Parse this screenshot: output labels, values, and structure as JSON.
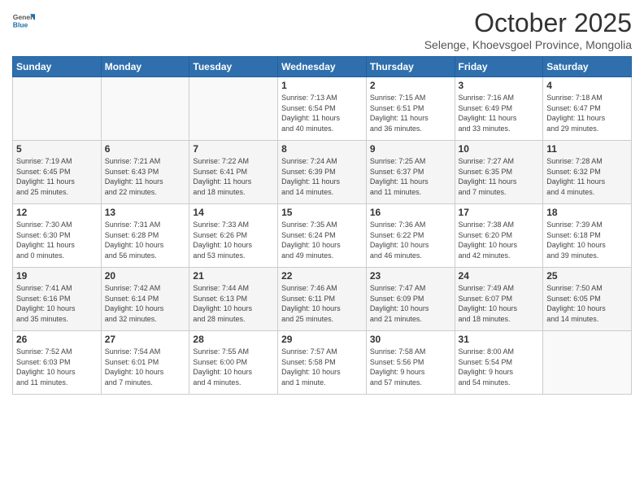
{
  "header": {
    "logo_general": "General",
    "logo_blue": "Blue",
    "title": "October 2025",
    "subtitle": "Selenge, Khoevsgoel Province, Mongolia"
  },
  "weekdays": [
    "Sunday",
    "Monday",
    "Tuesday",
    "Wednesday",
    "Thursday",
    "Friday",
    "Saturday"
  ],
  "weeks": [
    [
      {
        "day": "",
        "info": ""
      },
      {
        "day": "",
        "info": ""
      },
      {
        "day": "",
        "info": ""
      },
      {
        "day": "1",
        "info": "Sunrise: 7:13 AM\nSunset: 6:54 PM\nDaylight: 11 hours\nand 40 minutes."
      },
      {
        "day": "2",
        "info": "Sunrise: 7:15 AM\nSunset: 6:51 PM\nDaylight: 11 hours\nand 36 minutes."
      },
      {
        "day": "3",
        "info": "Sunrise: 7:16 AM\nSunset: 6:49 PM\nDaylight: 11 hours\nand 33 minutes."
      },
      {
        "day": "4",
        "info": "Sunrise: 7:18 AM\nSunset: 6:47 PM\nDaylight: 11 hours\nand 29 minutes."
      }
    ],
    [
      {
        "day": "5",
        "info": "Sunrise: 7:19 AM\nSunset: 6:45 PM\nDaylight: 11 hours\nand 25 minutes."
      },
      {
        "day": "6",
        "info": "Sunrise: 7:21 AM\nSunset: 6:43 PM\nDaylight: 11 hours\nand 22 minutes."
      },
      {
        "day": "7",
        "info": "Sunrise: 7:22 AM\nSunset: 6:41 PM\nDaylight: 11 hours\nand 18 minutes."
      },
      {
        "day": "8",
        "info": "Sunrise: 7:24 AM\nSunset: 6:39 PM\nDaylight: 11 hours\nand 14 minutes."
      },
      {
        "day": "9",
        "info": "Sunrise: 7:25 AM\nSunset: 6:37 PM\nDaylight: 11 hours\nand 11 minutes."
      },
      {
        "day": "10",
        "info": "Sunrise: 7:27 AM\nSunset: 6:35 PM\nDaylight: 11 hours\nand 7 minutes."
      },
      {
        "day": "11",
        "info": "Sunrise: 7:28 AM\nSunset: 6:32 PM\nDaylight: 11 hours\nand 4 minutes."
      }
    ],
    [
      {
        "day": "12",
        "info": "Sunrise: 7:30 AM\nSunset: 6:30 PM\nDaylight: 11 hours\nand 0 minutes."
      },
      {
        "day": "13",
        "info": "Sunrise: 7:31 AM\nSunset: 6:28 PM\nDaylight: 10 hours\nand 56 minutes."
      },
      {
        "day": "14",
        "info": "Sunrise: 7:33 AM\nSunset: 6:26 PM\nDaylight: 10 hours\nand 53 minutes."
      },
      {
        "day": "15",
        "info": "Sunrise: 7:35 AM\nSunset: 6:24 PM\nDaylight: 10 hours\nand 49 minutes."
      },
      {
        "day": "16",
        "info": "Sunrise: 7:36 AM\nSunset: 6:22 PM\nDaylight: 10 hours\nand 46 minutes."
      },
      {
        "day": "17",
        "info": "Sunrise: 7:38 AM\nSunset: 6:20 PM\nDaylight: 10 hours\nand 42 minutes."
      },
      {
        "day": "18",
        "info": "Sunrise: 7:39 AM\nSunset: 6:18 PM\nDaylight: 10 hours\nand 39 minutes."
      }
    ],
    [
      {
        "day": "19",
        "info": "Sunrise: 7:41 AM\nSunset: 6:16 PM\nDaylight: 10 hours\nand 35 minutes."
      },
      {
        "day": "20",
        "info": "Sunrise: 7:42 AM\nSunset: 6:14 PM\nDaylight: 10 hours\nand 32 minutes."
      },
      {
        "day": "21",
        "info": "Sunrise: 7:44 AM\nSunset: 6:13 PM\nDaylight: 10 hours\nand 28 minutes."
      },
      {
        "day": "22",
        "info": "Sunrise: 7:46 AM\nSunset: 6:11 PM\nDaylight: 10 hours\nand 25 minutes."
      },
      {
        "day": "23",
        "info": "Sunrise: 7:47 AM\nSunset: 6:09 PM\nDaylight: 10 hours\nand 21 minutes."
      },
      {
        "day": "24",
        "info": "Sunrise: 7:49 AM\nSunset: 6:07 PM\nDaylight: 10 hours\nand 18 minutes."
      },
      {
        "day": "25",
        "info": "Sunrise: 7:50 AM\nSunset: 6:05 PM\nDaylight: 10 hours\nand 14 minutes."
      }
    ],
    [
      {
        "day": "26",
        "info": "Sunrise: 7:52 AM\nSunset: 6:03 PM\nDaylight: 10 hours\nand 11 minutes."
      },
      {
        "day": "27",
        "info": "Sunrise: 7:54 AM\nSunset: 6:01 PM\nDaylight: 10 hours\nand 7 minutes."
      },
      {
        "day": "28",
        "info": "Sunrise: 7:55 AM\nSunset: 6:00 PM\nDaylight: 10 hours\nand 4 minutes."
      },
      {
        "day": "29",
        "info": "Sunrise: 7:57 AM\nSunset: 5:58 PM\nDaylight: 10 hours\nand 1 minute."
      },
      {
        "day": "30",
        "info": "Sunrise: 7:58 AM\nSunset: 5:56 PM\nDaylight: 9 hours\nand 57 minutes."
      },
      {
        "day": "31",
        "info": "Sunrise: 8:00 AM\nSunset: 5:54 PM\nDaylight: 9 hours\nand 54 minutes."
      },
      {
        "day": "",
        "info": ""
      }
    ]
  ]
}
